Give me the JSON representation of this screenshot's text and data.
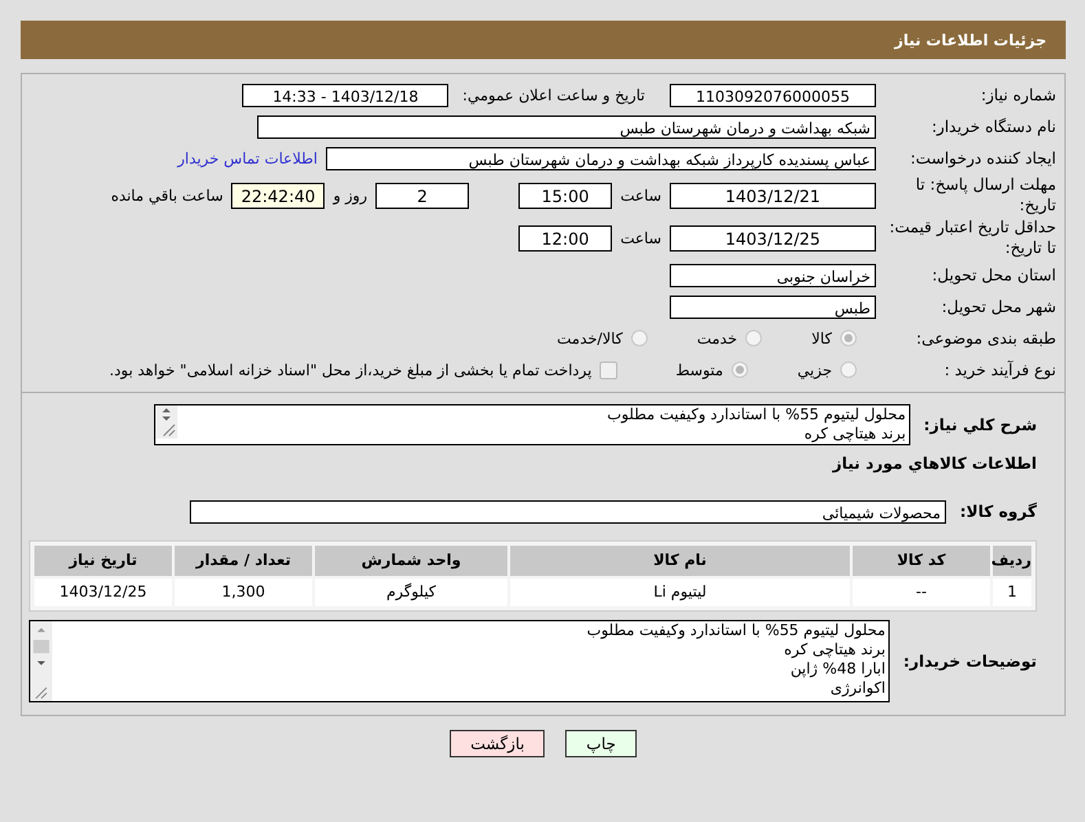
{
  "header": {
    "title": "جزئیات اطلاعات نیاز"
  },
  "need_number": {
    "label": "شماره نیاز:",
    "value": "1103092076000055"
  },
  "announce": {
    "label": "تاریخ و ساعت اعلان عمومي:",
    "value": "1403/12/18 - 14:33"
  },
  "buyer": {
    "label": "نام دستگاه خریدار:",
    "value": "شبکه بهداشت و درمان شهرستان طبس"
  },
  "creator": {
    "label": "ایجاد کننده درخواست:",
    "value": "عباس پسندیده کارپرداز شبکه بهداشت و درمان شهرستان طبس",
    "link": "اطلاعات تماس خریدار"
  },
  "deadline": {
    "label": "مهلت ارسال پاسخ: تا تاریخ:",
    "date": "1403/12/21",
    "time_label": "ساعت",
    "time": "15:00",
    "days": "2",
    "days_label": "روز و",
    "remaining": "22:42:40",
    "remaining_label": "ساعت باقي مانده"
  },
  "validity": {
    "label": "حداقل تاریخ اعتبار قیمت: تا تاریخ:",
    "date": "1403/12/25",
    "time_label": "ساعت",
    "time": "12:00"
  },
  "province": {
    "label": "استان محل تحویل:",
    "value": "خراسان جنوبی"
  },
  "city": {
    "label": "شهر محل تحویل:",
    "value": "طبس"
  },
  "category": {
    "label": "طبقه بندی موضوعی:",
    "options": [
      {
        "label": "کالا",
        "selected": true
      },
      {
        "label": "خدمت",
        "selected": false
      },
      {
        "label": "کالا/خدمت",
        "selected": false
      }
    ]
  },
  "process": {
    "label": "نوع فرآیند خرید :",
    "options": [
      {
        "label": "جزیي",
        "selected": false
      },
      {
        "label": "متوسط",
        "selected": true
      }
    ],
    "payment": {
      "checked": false,
      "text": "پرداخت تمام یا بخشی از مبلغ خرید،از محل \"اسناد خزانه اسلامی\" خواهد بود."
    }
  },
  "description": {
    "label": "شرح کلي نیاز:",
    "value": "محلول لیتیوم 55% با استاندارد وکیفیت مطلوب\nبرند هیتاچی کره"
  },
  "goods_title": "اطلاعات کالاهاي مورد نیاز",
  "goods_group": {
    "label": "گروه کالا:",
    "value": "محصولات شیمیائی"
  },
  "table": {
    "columns": [
      "ردیف",
      "کد کالا",
      "نام کالا",
      "واحد شمارش",
      "تعداد / مقدار",
      "تاریخ نیاز"
    ],
    "rows": [
      [
        "1",
        "--",
        "لیتیوم Li",
        "کیلوگرم",
        "1,300",
        "1403/12/25"
      ]
    ]
  },
  "buyer_notes": {
    "label": "توضیحات خریدار:",
    "value": "محلول لیتیوم 55% با استاندارد وکیفیت مطلوب\nبرند هیتاچی کره\nابارا 48% ژاپن\nاکوانرژی"
  },
  "buttons": [
    {
      "kind": "print",
      "label": "چاپ"
    },
    {
      "kind": "back",
      "label": "بازگشت"
    }
  ]
}
